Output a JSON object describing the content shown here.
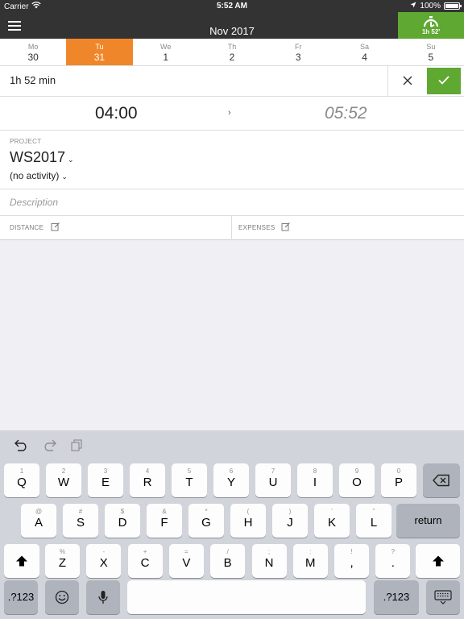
{
  "status_bar": {
    "carrier": "Carrier",
    "time": "5:52 AM",
    "battery": "100%",
    "battery_level": 1.0
  },
  "header": {
    "month": "Nov 2017",
    "timer_label": "1h 52'",
    "menu_icon": "hamburger-icon",
    "timer_icon": "stopwatch-icon"
  },
  "week": {
    "active_index": 1,
    "days": [
      {
        "name": "Mo",
        "date": "30"
      },
      {
        "name": "Tu",
        "date": "31"
      },
      {
        "name": "We",
        "date": "1"
      },
      {
        "name": "Th",
        "date": "2"
      },
      {
        "name": "Fr",
        "date": "3"
      },
      {
        "name": "Sa",
        "date": "4"
      },
      {
        "name": "Su",
        "date": "5"
      }
    ]
  },
  "entry": {
    "duration": "1h 52 min",
    "start_time": "04:00",
    "end_time": "05:52",
    "project_label": "PROJECT",
    "project": "WS2017",
    "activity": "(no activity)",
    "description_placeholder": "Description",
    "distance_label": "DISTANCE",
    "expenses_label": "EXPENSES"
  },
  "colors": {
    "accent_green": "#5fa832",
    "accent_orange": "#f0862a",
    "header_dark": "#333333"
  },
  "keyboard": {
    "row1": [
      {
        "alt": "1",
        "main": "Q"
      },
      {
        "alt": "2",
        "main": "W"
      },
      {
        "alt": "3",
        "main": "E"
      },
      {
        "alt": "4",
        "main": "R"
      },
      {
        "alt": "5",
        "main": "T"
      },
      {
        "alt": "6",
        "main": "Y"
      },
      {
        "alt": "7",
        "main": "U"
      },
      {
        "alt": "8",
        "main": "I"
      },
      {
        "alt": "9",
        "main": "O"
      },
      {
        "alt": "0",
        "main": "P"
      }
    ],
    "row2": [
      {
        "alt": "@",
        "main": "A"
      },
      {
        "alt": "#",
        "main": "S"
      },
      {
        "alt": "$",
        "main": "D"
      },
      {
        "alt": "&",
        "main": "F"
      },
      {
        "alt": "*",
        "main": "G"
      },
      {
        "alt": "(",
        "main": "H"
      },
      {
        "alt": ")",
        "main": "J"
      },
      {
        "alt": "’",
        "main": "K"
      },
      {
        "alt": "”",
        "main": "L"
      }
    ],
    "row3": [
      {
        "alt": "%",
        "main": "Z"
      },
      {
        "alt": "-",
        "main": "X"
      },
      {
        "alt": "+",
        "main": "C"
      },
      {
        "alt": "=",
        "main": "V"
      },
      {
        "alt": "/",
        "main": "B"
      },
      {
        "alt": ";",
        "main": "N"
      },
      {
        "alt": ":",
        "main": "M"
      },
      {
        "alt": "!",
        "main": ","
      },
      {
        "alt": "?",
        "main": "."
      }
    ],
    "return_label": "return",
    "numbers_label": ".?123"
  }
}
